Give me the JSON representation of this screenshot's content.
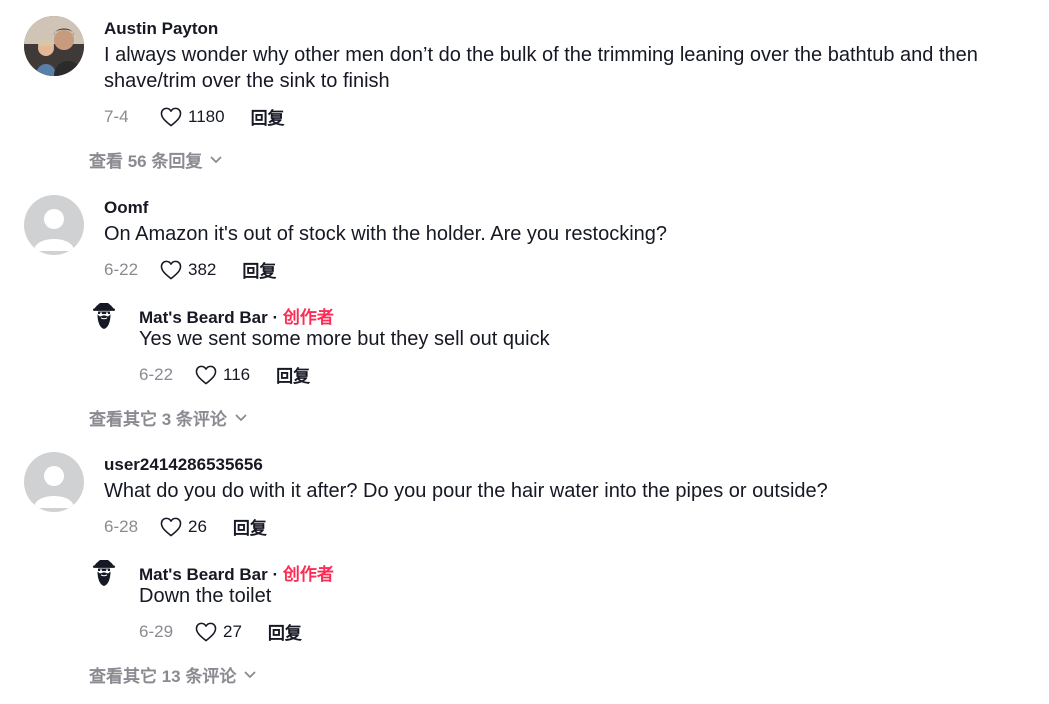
{
  "comments": [
    {
      "author": "Austin Payton",
      "text_line1": "I always wonder why other men don’t do the bulk of the trimming leaning over the bathtub and then",
      "text_line2": "shave/trim over the sink to finish",
      "date": "7-4",
      "likes": "1180",
      "reply_label": "回复",
      "view_more": "查看 56 条回复"
    },
    {
      "author": "Oomf",
      "text": "On Amazon it's out of stock with the holder. Are you restocking?",
      "date": "6-22",
      "likes": "382",
      "reply_label": "回复",
      "reply": {
        "author": "Mat's Beard Bar",
        "separator": " · ",
        "badge": "创作者",
        "text": "Yes we sent some more but they sell out quick",
        "date": "6-22",
        "likes": "116",
        "reply_label": "回复"
      },
      "view_more": "查看其它 3 条评论"
    },
    {
      "author": "user2414286535656",
      "text": "What do you do with it after? Do you pour the hair water into the pipes or outside?",
      "date": "6-28",
      "likes": "26",
      "reply_label": "回复",
      "reply": {
        "author": "Mat's Beard Bar",
        "separator": " · ",
        "badge": "创作者",
        "text": "Down the toilet",
        "date": "6-29",
        "likes": "27",
        "reply_label": "回复"
      },
      "view_more": "查看其它 13 条评论"
    }
  ],
  "colors": {
    "creator_badge": "#fe2c55",
    "muted": "#8a8b91",
    "text": "#161823"
  },
  "icons": {
    "like": "heart-outline-icon",
    "expand": "chevron-down-icon"
  }
}
